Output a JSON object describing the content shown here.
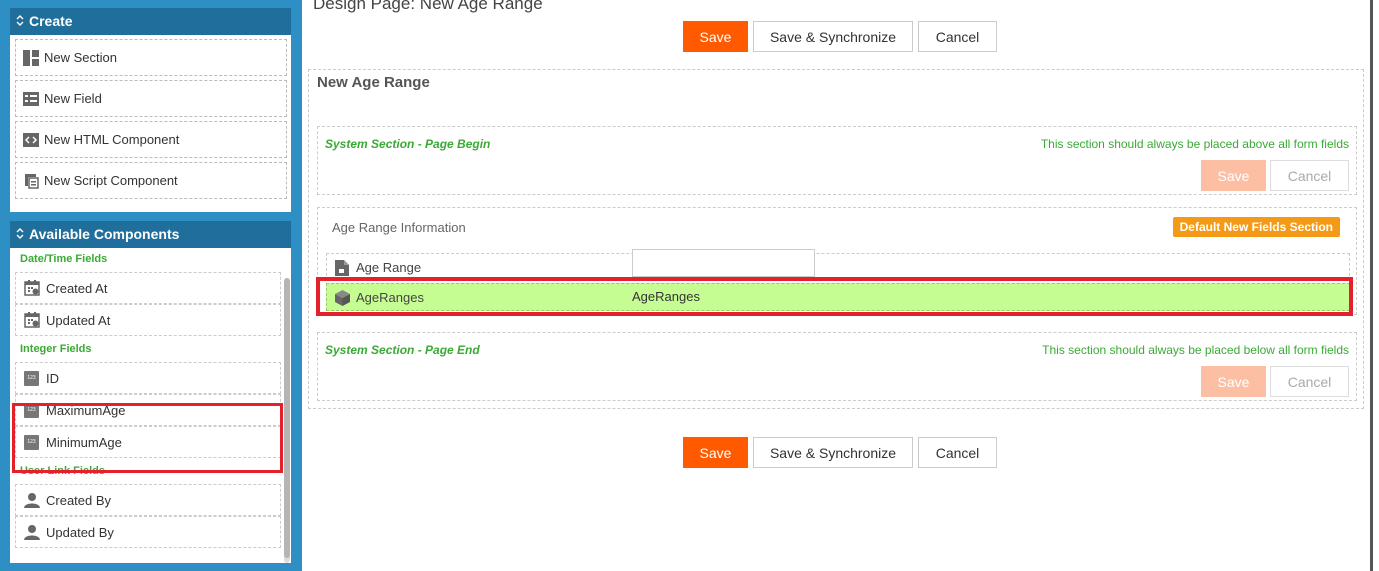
{
  "sidebar": {
    "create": {
      "title": "Create",
      "items": [
        {
          "label": "New Section",
          "icon": "section-icon"
        },
        {
          "label": "New Field",
          "icon": "field-icon"
        },
        {
          "label": "New HTML Component",
          "icon": "html-icon"
        },
        {
          "label": "New Script Component",
          "icon": "script-icon"
        }
      ]
    },
    "available": {
      "title": "Available Components",
      "groups": [
        {
          "title": "Date/Time Fields",
          "items": [
            {
              "label": "Created At",
              "icon": "calendar-icon"
            },
            {
              "label": "Updated At",
              "icon": "calendar-icon"
            }
          ]
        },
        {
          "title": "Integer Fields",
          "items": [
            {
              "label": "ID",
              "icon": "number-icon"
            },
            {
              "label": "MaximumAge",
              "icon": "number-icon"
            },
            {
              "label": "MinimumAge",
              "icon": "number-icon"
            }
          ]
        },
        {
          "title": "User Link Fields",
          "items": [
            {
              "label": "Created By",
              "icon": "user-icon"
            },
            {
              "label": "Updated By",
              "icon": "user-icon"
            }
          ]
        }
      ]
    }
  },
  "main": {
    "design_title": "Design Page: New Age Range",
    "buttons": {
      "save": "Save",
      "save_sync": "Save & Synchronize",
      "cancel": "Cancel"
    },
    "form_title": "New Age Range",
    "page_begin": {
      "title": "System Section - Page Begin",
      "note": "This section should always be placed above all form fields",
      "save": "Save",
      "cancel": "Cancel"
    },
    "info_section": {
      "title": "Age Range Information",
      "badge": "Default New Fields Section",
      "fields": [
        {
          "label": "Age Range",
          "value": ""
        },
        {
          "label": "AgeRanges",
          "value": "AgeRanges"
        }
      ]
    },
    "page_end": {
      "title": "System Section - Page End",
      "note": "This section should always be placed below all form fields",
      "save": "Save",
      "cancel": "Cancel"
    }
  },
  "colors": {
    "accent": "#ff5a00",
    "sidebar_bg": "#2d8fc4",
    "panel_header": "#1f6e9c",
    "success_text": "#3aaa35",
    "highlight_row": "#c6fd92",
    "annotation_red": "#e3202b",
    "badge": "#f49a16"
  }
}
